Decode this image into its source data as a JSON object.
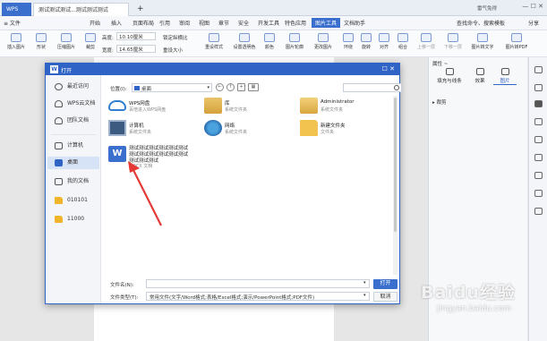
{
  "titlebar": {
    "app": "WPS",
    "doc_tab": "测试测试测试...测试测试测试",
    "add_tab": "+",
    "user": "雷气兔得",
    "win_controls": "— ☐ ✕"
  },
  "menubar": {
    "items": [
      "≡ 文件",
      "开始",
      "插入",
      "页面布局",
      "引用",
      "审阅",
      "视图",
      "章节",
      "安全",
      "开发工具",
      "特色应用",
      "图片工具",
      "文档助手"
    ],
    "active": "图片工具",
    "search": "查找命令、搜索模板",
    "share": "分享"
  },
  "toolbar": {
    "buttons": [
      "插入图片",
      "形状",
      "压缩图片",
      "裁剪",
      "清除背景",
      "图片轮廓",
      "更改图片",
      "环绕",
      "旋转",
      "对齐",
      "组合",
      "上移一层",
      "下移一层",
      "选择窗格",
      "图片转文字",
      "图片转PDF"
    ],
    "height_label": "高度:",
    "height_value": "10.10厘米",
    "width_label": "宽度:",
    "width_value": "14.65厘米",
    "lock_ratio": "锁定纵横比",
    "reset_size": "重设大小",
    "effects": "图片效果",
    "set_transparent": "设置透明色",
    "color": "颜色",
    "reset_style": "重设样式"
  },
  "dialog": {
    "title": "打开",
    "sidebar": [
      {
        "label": "最近访问",
        "icon": "clock-icon"
      },
      {
        "label": "WPS云文档",
        "icon": "cloud-icon"
      },
      {
        "label": "团队文档",
        "icon": "team-icon"
      },
      {
        "label": "计算机",
        "icon": "computer-icon"
      },
      {
        "label": "桌面",
        "icon": "desktop-icon"
      },
      {
        "label": "我的文档",
        "icon": "document-icon"
      },
      {
        "label": "010101",
        "icon": "folder-icon"
      },
      {
        "label": "11000",
        "icon": "folder-icon"
      }
    ],
    "location_label": "位置(I):",
    "location_value": "桌面",
    "files": [
      {
        "name": "WPS网盘",
        "sub": "百倍进入WPS网盘"
      },
      {
        "name": "库",
        "sub": "系统文件夹"
      },
      {
        "name": "Administrator",
        "sub": "系统文件夹"
      },
      {
        "name": "计算机",
        "sub": "系统文件夹"
      },
      {
        "name": "网络",
        "sub": "系统文件夹"
      },
      {
        "name": "新建文件夹",
        "sub": "文件夹"
      }
    ],
    "doc_file": {
      "line1": "测试测试测试测试测试测试",
      "line2": "测试测试测试测试测试测试",
      "line3": "测试测试测试",
      "type": "DOCX 文档"
    },
    "filename_label": "文件名(N):",
    "filename_value": "",
    "filetype_label": "文件类型(T):",
    "filetype_value": "常用文件(文字/Word格式;表格/Excel格式;演示/PowerPoint格式;PDF文件)",
    "open_label": "打开",
    "cancel_label": "取消"
  },
  "panel": {
    "title": "属性 ~",
    "tabs": [
      "填充与线条",
      "效果",
      "图片"
    ],
    "section": "▸ 裁剪"
  },
  "watermark": {
    "main": "Baidu经验",
    "sub": "jingyan.baidu.com"
  },
  "colors": {
    "accent": "#2f63c6",
    "arrow": "#e53935"
  }
}
